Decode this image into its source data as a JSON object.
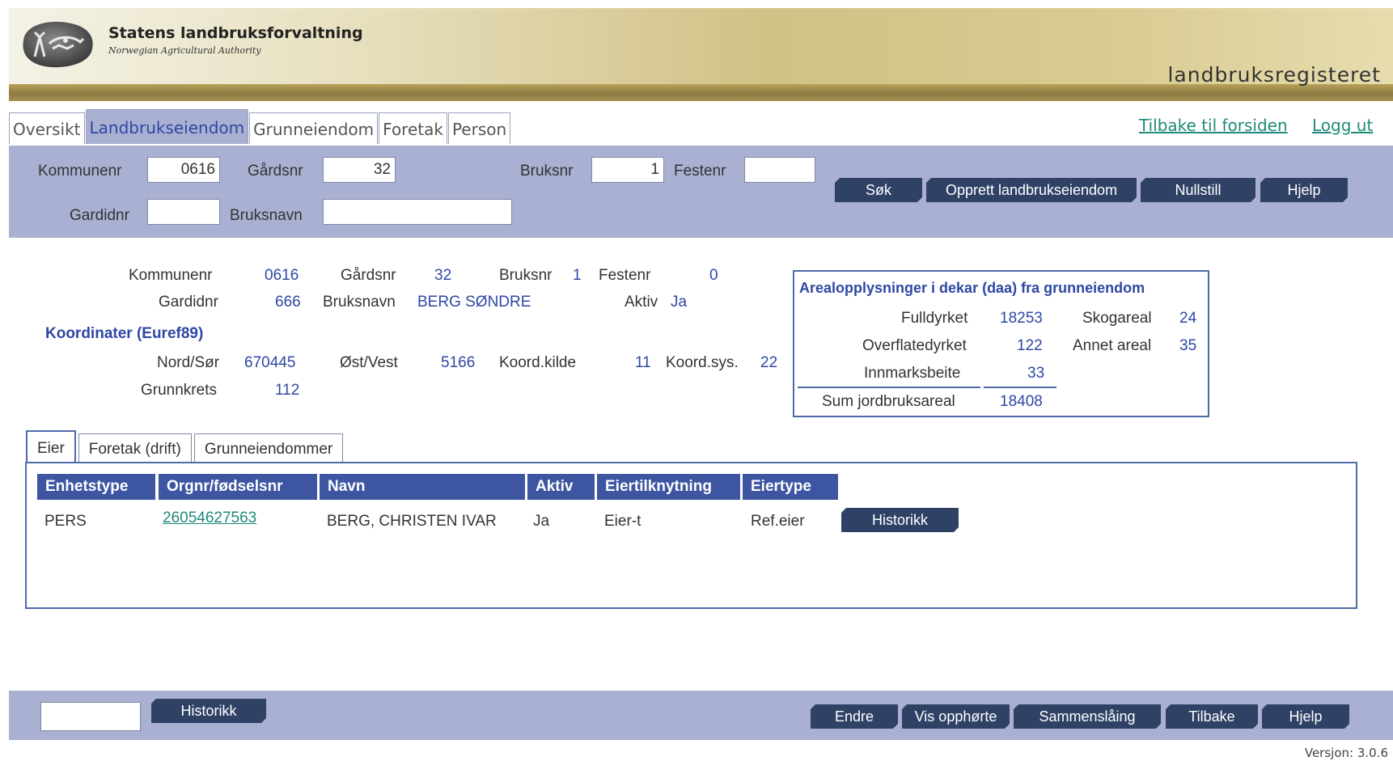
{
  "header": {
    "org_name": "Statens landbruksforvaltning",
    "org_sub": "Norwegian Agricultural Authority",
    "register_name": "landbruksregisteret"
  },
  "main_tabs": [
    {
      "label": "Oversikt",
      "active": false
    },
    {
      "label": "Landbrukseiendom",
      "active": true
    },
    {
      "label": "Grunneiendom",
      "active": false
    },
    {
      "label": "Foretak",
      "active": false
    },
    {
      "label": "Person",
      "active": false
    }
  ],
  "top_links": {
    "home": "Tilbake til forsiden",
    "logout": "Logg ut"
  },
  "search": {
    "kommunenr_label": "Kommunenr",
    "kommunenr_value": "0616",
    "gardsnr_label": "Gårdsnr",
    "gardsnr_value": "32",
    "bruksnr_label": "Bruksnr",
    "bruksnr_value": "1",
    "festenr_label": "Festenr",
    "festenr_value": "",
    "gardidnr_label": "Gardidnr",
    "gardidnr_value": "",
    "bruksnavn_label": "Bruksnavn",
    "bruksnavn_value": "",
    "buttons": {
      "search": "Søk",
      "create": "Opprett landbrukseiendom",
      "reset": "Nullstill",
      "help": "Hjelp"
    }
  },
  "property": {
    "kommunenr_label": "Kommunenr",
    "kommunenr": "0616",
    "gardsnr_label": "Gårdsnr",
    "gardsnr": "32",
    "bruksnr_label": "Bruksnr",
    "bruksnr": "1",
    "festenr_label": "Festenr",
    "festenr": "0",
    "gardidnr_label": "Gardidnr",
    "gardidnr": "666",
    "bruksnavn_label": "Bruksnavn",
    "bruksnavn": "BERG SØNDRE",
    "aktiv_label": "Aktiv",
    "aktiv": "Ja",
    "coords_title": "Koordinater (Euref89)",
    "nord_label": "Nord/Sør",
    "nord": "670445",
    "ost_label": "Øst/Vest",
    "ost": "5166",
    "koordkilde_label": "Koord.kilde",
    "koordkilde": "11",
    "koordsys_label": "Koord.sys.",
    "koordsys": "22",
    "grunnkrets_label": "Grunnkrets",
    "grunnkrets": "112"
  },
  "area": {
    "title": "Arealopplysninger i dekar (daa) fra grunneiendom",
    "fulldyrket_label": "Fulldyrket",
    "fulldyrket": "18253",
    "overflate_label": "Overflatedyrket",
    "overflate": "122",
    "innmark_label": "Innmarksbeite",
    "innmark": "33",
    "sum_label": "Sum jordbruksareal",
    "sum": "18408",
    "skog_label": "Skogareal",
    "skog": "24",
    "annet_label": "Annet areal",
    "annet": "35"
  },
  "sub_tabs": [
    {
      "label": "Eier",
      "active": true
    },
    {
      "label": "Foretak (drift)",
      "active": false
    },
    {
      "label": "Grunneiendommer",
      "active": false
    }
  ],
  "owners_table": {
    "headers": [
      "Enhetstype",
      "Orgnr/fødselsnr",
      "Navn",
      "Aktiv",
      "Eiertilknytning",
      "Eiertype"
    ],
    "rows": [
      {
        "enhetstype": "PERS",
        "orgnr": "26054627563",
        "navn": "BERG, CHRISTEN IVAR",
        "aktiv": "Ja",
        "eiertilknytning": "Eier-t",
        "eiertype": "Ref.eier",
        "button": "Historikk"
      }
    ]
  },
  "bottom": {
    "input_value": "",
    "historikk": "Historikk",
    "buttons": {
      "edit": "Endre",
      "show_ended": "Vis opphørte",
      "merge": "Sammenslåing",
      "back": "Tilbake",
      "help": "Hjelp"
    }
  },
  "version": "Versjon: 3.0.6"
}
